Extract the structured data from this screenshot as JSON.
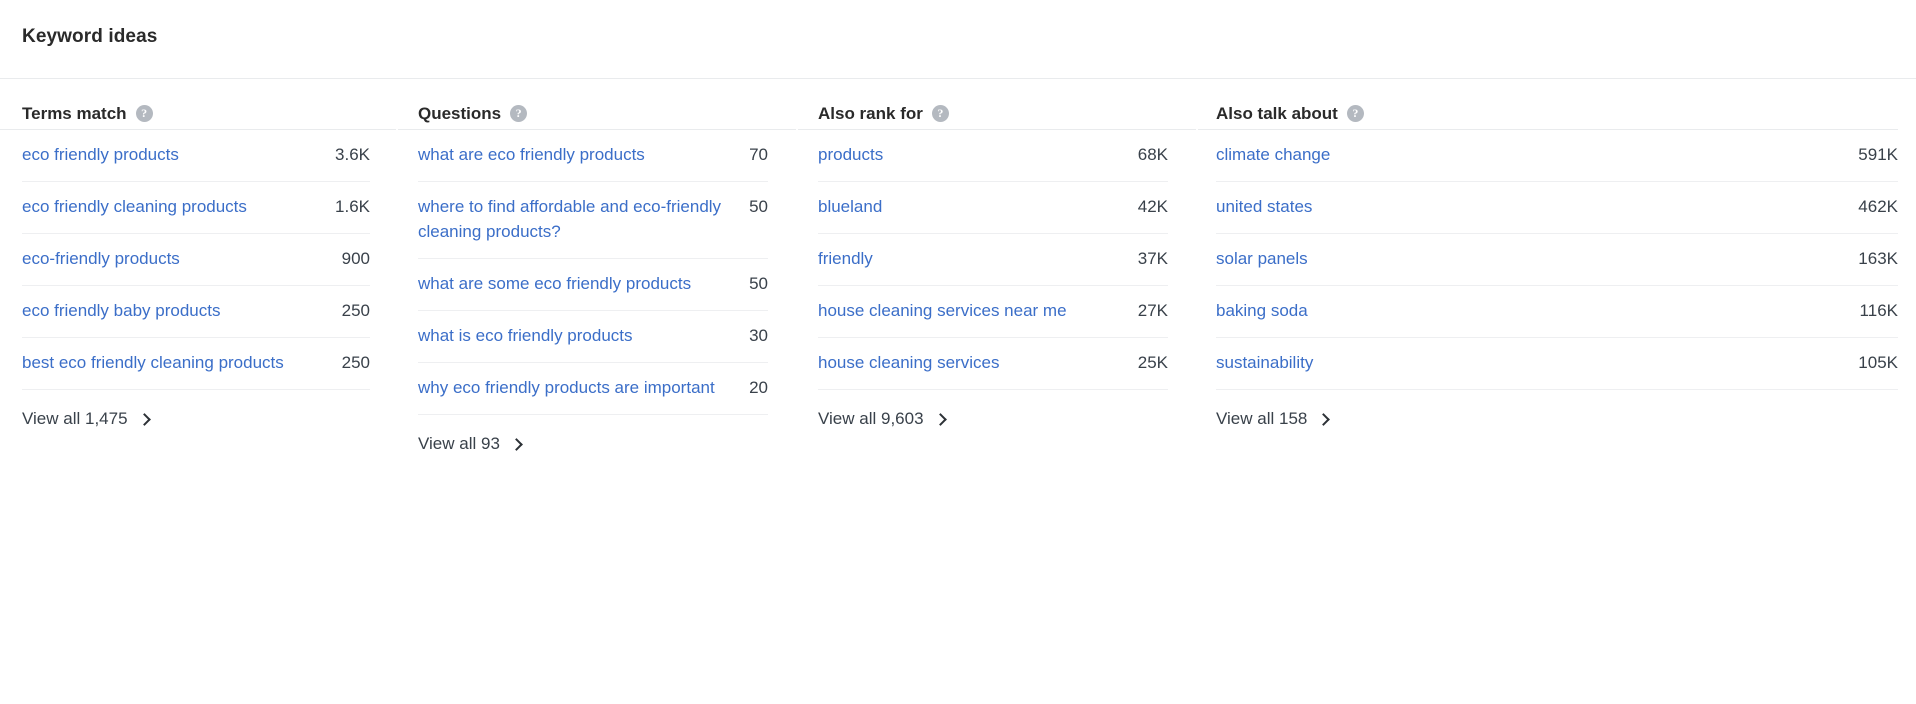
{
  "panel": {
    "title": "Keyword ideas"
  },
  "help_icon_glyph": "?",
  "colors": {
    "link": "#3b6ec8",
    "text": "#39414a",
    "heading": "#2a2a2a",
    "rule": "#e9ebed",
    "help_badge": "#b4b9c0"
  },
  "columns": [
    {
      "header": "Terms match",
      "rows": [
        {
          "keyword": "eco friendly products",
          "volume": "3.6K"
        },
        {
          "keyword": "eco friendly cleaning products",
          "volume": "1.6K"
        },
        {
          "keyword": "eco-friendly products",
          "volume": "900"
        },
        {
          "keyword": "eco friendly baby products",
          "volume": "250"
        },
        {
          "keyword": "best eco friendly cleaning products",
          "volume": "250"
        }
      ],
      "view_all": "View all 1,475"
    },
    {
      "header": "Questions",
      "rows": [
        {
          "keyword": "what are eco friendly products",
          "volume": "70"
        },
        {
          "keyword": "where to find affordable and eco-friendly cleaning products?",
          "volume": "50"
        },
        {
          "keyword": "what are some eco friendly products",
          "volume": "50"
        },
        {
          "keyword": "what is eco friendly products",
          "volume": "30"
        },
        {
          "keyword": "why eco friendly products are important",
          "volume": "20"
        }
      ],
      "view_all": "View all 93"
    },
    {
      "header": "Also rank for",
      "rows": [
        {
          "keyword": "products",
          "volume": "68K"
        },
        {
          "keyword": "blueland",
          "volume": "42K"
        },
        {
          "keyword": "friendly",
          "volume": "37K"
        },
        {
          "keyword": "house cleaning services near me",
          "volume": "27K"
        },
        {
          "keyword": "house cleaning services",
          "volume": "25K"
        }
      ],
      "view_all": "View all 9,603"
    },
    {
      "header": "Also talk about",
      "rows": [
        {
          "keyword": "climate change",
          "volume": "591K"
        },
        {
          "keyword": "united states",
          "volume": "462K"
        },
        {
          "keyword": "solar panels",
          "volume": "163K"
        },
        {
          "keyword": "baking soda",
          "volume": "116K"
        },
        {
          "keyword": "sustainability",
          "volume": "105K"
        }
      ],
      "view_all": "View all 158"
    }
  ]
}
